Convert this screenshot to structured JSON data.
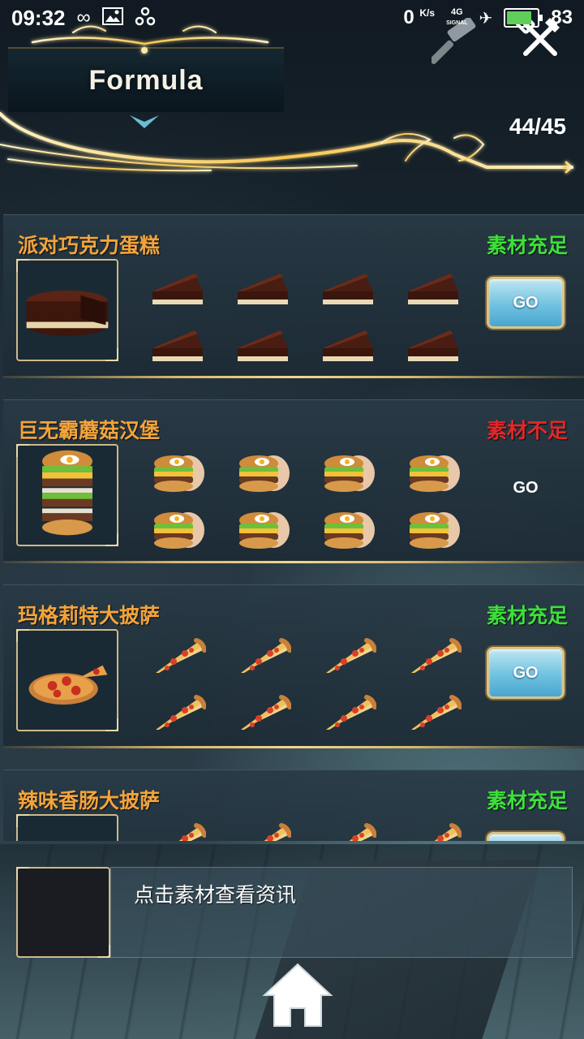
{
  "status_bar": {
    "time": "09:32",
    "icons": [
      "infinity-icon",
      "image-icon",
      "link-icon"
    ],
    "net_speed_value": "0",
    "net_speed_unit": "K/s",
    "net_type": "4G",
    "signal_label": "SIGNAL",
    "battery_level": 83,
    "battery_text": "83"
  },
  "header": {
    "title": "Formula",
    "count": "44/45",
    "icons": [
      "hammer-icon",
      "crossed-tools-icon"
    ]
  },
  "colors": {
    "name": "#f4a43a",
    "enough": "#3ee03a",
    "insufficient": "#e0282a",
    "gold": "#e8c76a"
  },
  "recipes": [
    {
      "name": "派对巧克力蛋糕",
      "status": "素材充足",
      "status_type": "enough",
      "material": "chocolate-cake-slice-icon",
      "dish": "chocolate-cake-icon",
      "go_label": "GO",
      "go_active": true
    },
    {
      "name": "巨无霸蘑菇汉堡",
      "status": "素材不足",
      "status_type": "insufficient",
      "material": "burger-icon",
      "dish": "tall-burger-icon",
      "go_label": "GO",
      "go_active": false
    },
    {
      "name": "玛格莉特大披萨",
      "status": "素材充足",
      "status_type": "enough",
      "material": "pizza-slice-icon",
      "dish": "pizza-icon",
      "go_label": "GO",
      "go_active": true
    },
    {
      "name": "辣味香肠大披萨",
      "status": "素材充足",
      "status_type": "enough",
      "material": "pizza-slice-icon",
      "dish": "pizza-icon",
      "go_label": "GO",
      "go_active": true
    }
  ],
  "info": {
    "text": "点击素材查看资讯"
  },
  "footer": {
    "home_icon": "home-icon"
  }
}
